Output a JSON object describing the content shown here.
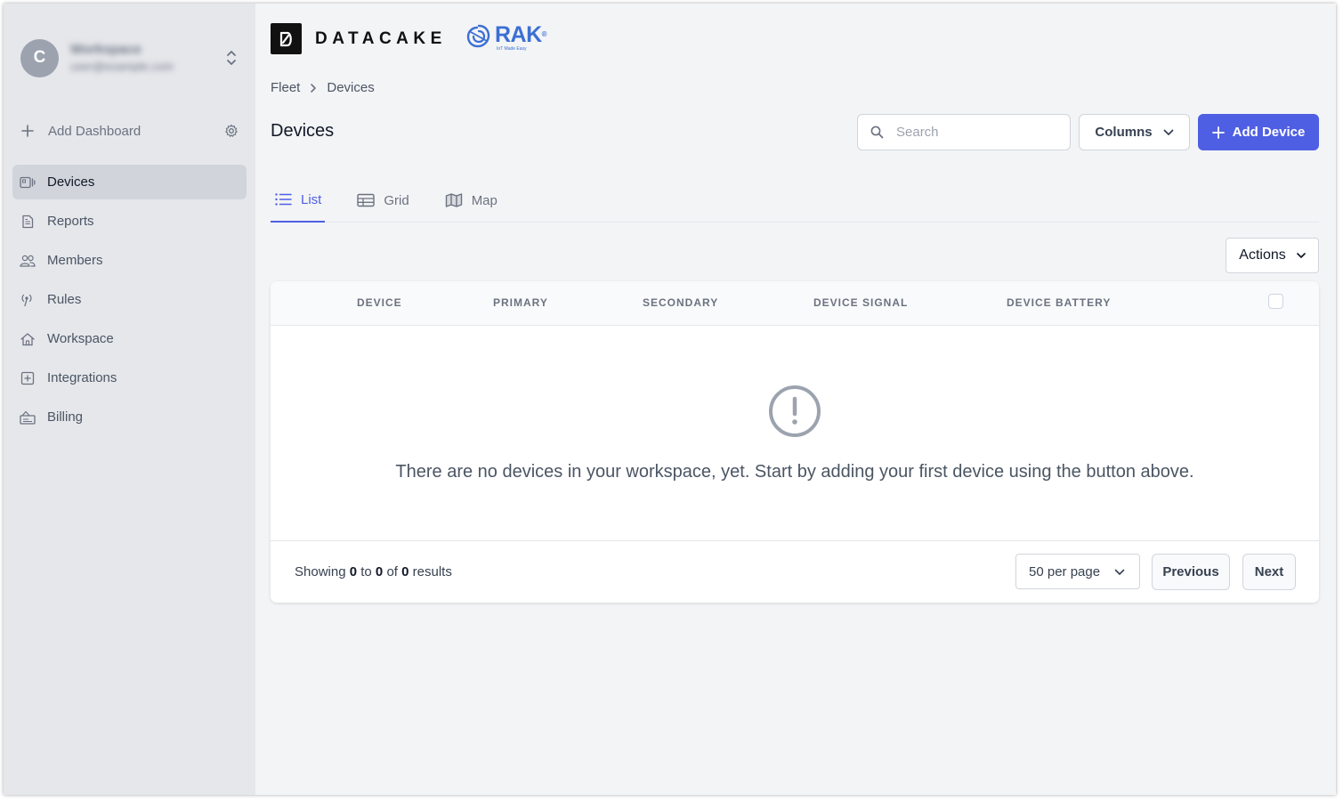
{
  "sidebar": {
    "workspace": {
      "avatar_letter": "C",
      "name": "Workspace",
      "email": "user@example.com"
    },
    "add_dashboard_label": "Add Dashboard",
    "items": [
      {
        "label": "Devices",
        "icon": "devices-icon",
        "active": true
      },
      {
        "label": "Reports",
        "icon": "document-icon",
        "active": false
      },
      {
        "label": "Members",
        "icon": "users-icon",
        "active": false
      },
      {
        "label": "Rules",
        "icon": "broadcast-icon",
        "active": false
      },
      {
        "label": "Workspace",
        "icon": "home-icon",
        "active": false
      },
      {
        "label": "Integrations",
        "icon": "plus-square-icon",
        "active": false
      },
      {
        "label": "Billing",
        "icon": "billing-icon",
        "active": false
      }
    ]
  },
  "header": {
    "brand_name": "DATACAKE",
    "partner_name": "RAK",
    "partner_mark": "®",
    "partner_tagline": "IoT Made Easy"
  },
  "breadcrumb": [
    "Fleet",
    "Devices"
  ],
  "page": {
    "title": "Devices"
  },
  "toolbar": {
    "search_placeholder": "Search",
    "search_value": "",
    "columns_label": "Columns",
    "add_device_label": "Add Device"
  },
  "tabs": [
    {
      "label": "List",
      "icon": "list-icon",
      "active": true
    },
    {
      "label": "Grid",
      "icon": "table-icon",
      "active": false
    },
    {
      "label": "Map",
      "icon": "map-icon",
      "active": false
    }
  ],
  "actions_label": "Actions",
  "table": {
    "columns": [
      "DEVICE",
      "PRIMARY",
      "SECONDARY",
      "DEVICE SIGNAL",
      "DEVICE BATTERY"
    ],
    "empty_message": "There are no devices in your workspace, yet. Start by adding your first device using the button above."
  },
  "pagination": {
    "showing_prefix": "Showing",
    "from": "0",
    "to_word": "to",
    "to": "0",
    "of_word": "of",
    "total": "0",
    "results_word": "results",
    "per_page_label": "50 per page",
    "previous_label": "Previous",
    "next_label": "Next"
  },
  "colors": {
    "accent": "#4f5fe3",
    "sidebar_bg": "#e5e7eb",
    "page_bg": "#f3f4f6",
    "rak_blue": "#3b6fd4"
  }
}
